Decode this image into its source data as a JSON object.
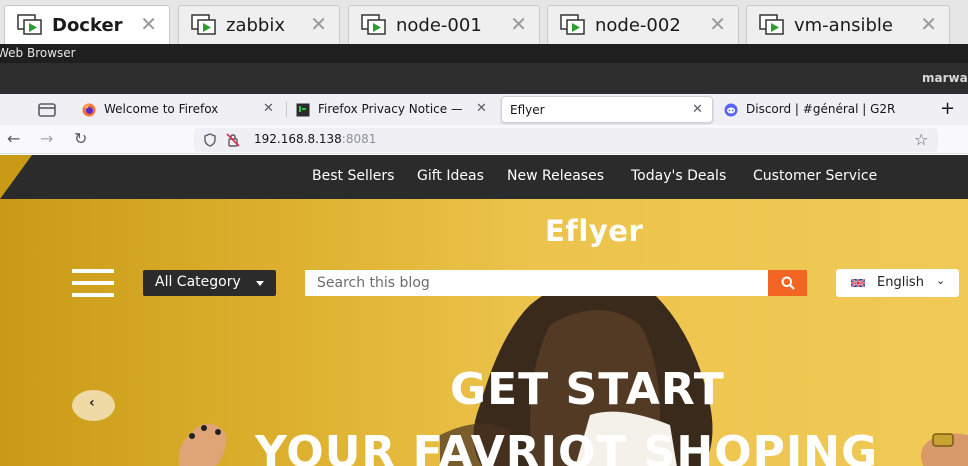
{
  "vm_tabs": [
    {
      "label": "Docker",
      "active": true
    },
    {
      "label": "zabbix",
      "active": false
    },
    {
      "label": "node-001",
      "active": false
    },
    {
      "label": "node-002",
      "active": false
    },
    {
      "label": "vm-ansible",
      "active": false
    }
  ],
  "app_bar": {
    "title": "Web Browser"
  },
  "panel": {
    "user": "marwa"
  },
  "browser": {
    "tabs": [
      {
        "label": "Welcome to Firefox",
        "favicon": "firefox-icon",
        "active": false
      },
      {
        "label": "Firefox Privacy Notice —",
        "favicon": "terminal-icon",
        "active": false
      },
      {
        "label": "Eflyer",
        "favicon": "",
        "active": true
      },
      {
        "label": "Discord | #général | G2R",
        "favicon": "discord-icon",
        "active": false
      }
    ],
    "new_tab": "+",
    "url": {
      "host": "192.168.8.138",
      "port": ":8081"
    }
  },
  "site": {
    "menu": [
      "Best Sellers",
      "Gift Ideas",
      "New Releases",
      "Today's Deals",
      "Customer Service"
    ],
    "logo": "Eflyer",
    "category_button": "All Category",
    "search_placeholder": "Search this blog",
    "language": "English",
    "hero_line1": "GET START",
    "hero_line2": "YOUR FAVRIOT SHOPING"
  },
  "colors": {
    "accent_orange": "#f26522",
    "hero_yellow": "#e6b73a",
    "menu_dark": "#2b2b2b",
    "vm_icon_green": "#2e9e2e"
  }
}
